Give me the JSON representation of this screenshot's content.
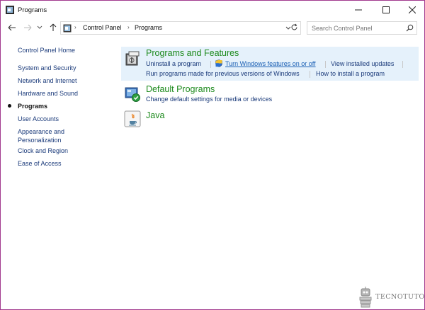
{
  "window": {
    "title": "Programs"
  },
  "address": {
    "breadcrumb": [
      "Control Panel",
      "Programs"
    ],
    "search_placeholder": "Search Control Panel"
  },
  "sidebar": {
    "items": [
      {
        "label": "Control Panel Home"
      },
      {
        "label": "System and Security"
      },
      {
        "label": "Network and Internet"
      },
      {
        "label": "Hardware and Sound"
      },
      {
        "label": "Programs",
        "active": true
      },
      {
        "label": "User Accounts"
      },
      {
        "label": "Appearance and"
      },
      {
        "label": "Personalization"
      },
      {
        "label": "Clock and Region"
      },
      {
        "label": "Ease of Access"
      }
    ]
  },
  "sections": {
    "programs_features": {
      "title": "Programs and Features",
      "links": {
        "uninstall": "Uninstall a program",
        "turn_features": "Turn Windows features on or off",
        "view_updates": "View installed updates",
        "run_older": "Run programs made for previous versions of Windows",
        "how_install": "How to install a program"
      }
    },
    "default_programs": {
      "title": "Default Programs",
      "links": {
        "change_defaults": "Change default settings for media or devices"
      }
    },
    "java": {
      "title": "Java"
    }
  },
  "watermark": {
    "text": "TECNOTUTO"
  },
  "colors": {
    "window_border": "#a23b8f",
    "section_title": "#1d8a1d",
    "link": "#1a3a7a",
    "highlight": "#e5f1fb"
  }
}
